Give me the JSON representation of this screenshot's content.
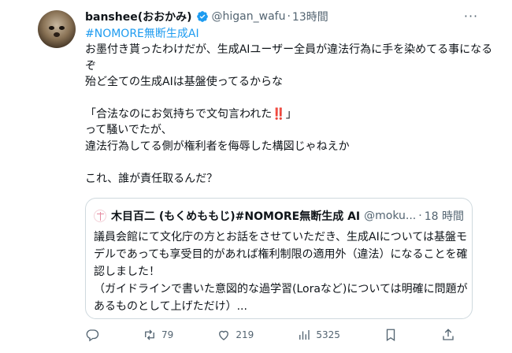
{
  "tweet": {
    "display_name": "banshee(おおかみ)",
    "handle": "@higan_wafu",
    "separator": "·",
    "time": "13時間",
    "more": "···",
    "hashtag": "#NOMORE無断生成AI",
    "text_1": "お墨付き貰ったわけだが、生成AIユーザー全員が違法行為に手を染めてる事になるぞ\n殆ど全ての生成AIは基盤使ってるからな\n\n「合法なのにお気持ちで文句言われた",
    "text_emoji": "‼️",
    "text_2": "」\nって騒いでたが、\n違法行為してる側が権利者を侮辱した構図じゃねえか\n\nこれ、誰が責任取るんだ？"
  },
  "quote": {
    "display_name": "木目百二 (もくめももじ)#NOMORE無断生成 AI",
    "handle": "@moku...",
    "separator": "·",
    "time": "18 時間",
    "text": "議員会館にて文化庁の方とお話をさせていただき、生成AIについては基盤モデルであっても享受目的があれば権利制限の適用外（違法）になることを確認しました！\n（ガイドラインで書いた意図的な過学習(Loraなど)については明確に問題があるものとして上げただけ）..."
  },
  "actions": {
    "retweets": "79",
    "likes": "219",
    "views": "5325"
  },
  "colors": {
    "link": "#1d9bf0",
    "secondary_text": "#536471",
    "border": "#cfd9de",
    "verified": "#1d9bf0"
  },
  "icons": [
    "verified-badge-icon",
    "more-icon",
    "reply-icon",
    "retweet-icon",
    "like-icon",
    "views-icon",
    "bookmark-icon",
    "share-icon"
  ]
}
